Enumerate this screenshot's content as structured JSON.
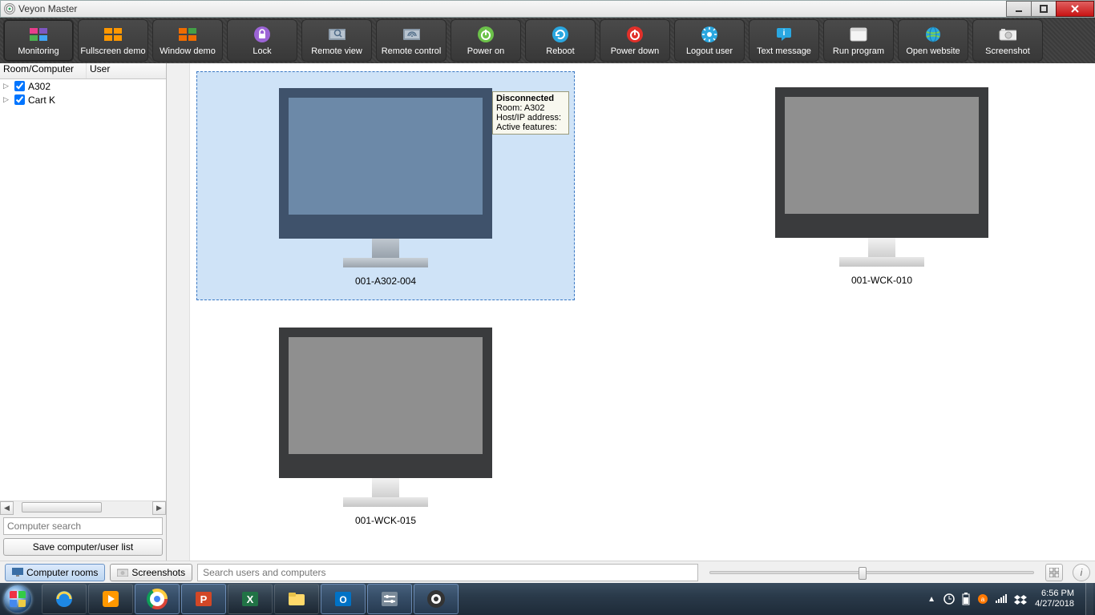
{
  "window": {
    "title": "Veyon Master"
  },
  "toolbar": [
    {
      "label": "Monitoring",
      "icon": "tiles-multi",
      "active": true
    },
    {
      "label": "Fullscreen demo",
      "icon": "tiles-orange"
    },
    {
      "label": "Window demo",
      "icon": "tiles-orange2"
    },
    {
      "label": "Lock",
      "icon": "lock"
    },
    {
      "label": "Remote view",
      "icon": "magnify-screen"
    },
    {
      "label": "Remote control",
      "icon": "wifi-screen"
    },
    {
      "label": "Power on",
      "icon": "power-green"
    },
    {
      "label": "Reboot",
      "icon": "reload-blue"
    },
    {
      "label": "Power down",
      "icon": "power-red"
    },
    {
      "label": "Logout user",
      "icon": "sun-blue"
    },
    {
      "label": "Text message",
      "icon": "chat-blue"
    },
    {
      "label": "Run program",
      "icon": "window-white"
    },
    {
      "label": "Open website",
      "icon": "globe"
    },
    {
      "label": "Screenshot",
      "icon": "camera"
    }
  ],
  "tree": {
    "headers": {
      "col1": "Room/Computer",
      "col2": "User"
    },
    "rows": [
      {
        "label": "A302",
        "checked": true
      },
      {
        "label": "Cart K",
        "checked": true
      }
    ]
  },
  "sidebar": {
    "search_placeholder": "Computer search",
    "save_label": "Save computer/user list"
  },
  "computers": [
    {
      "name": "001-A302-004",
      "selected": true,
      "state": "selected"
    },
    {
      "name": "001-WCK-010",
      "selected": false,
      "state": "off"
    },
    {
      "name": "001-WCK-015",
      "selected": false,
      "state": "off"
    }
  ],
  "tooltip": {
    "title": "Disconnected",
    "room": "Room: A302",
    "host": "Host/IP address:",
    "features": "Active features:"
  },
  "bottom": {
    "tab_rooms": "Computer rooms",
    "tab_screenshots": "Screenshots",
    "search_placeholder": "Search users and computers"
  },
  "clock": {
    "time": "6:56 PM",
    "date": "4/27/2018"
  }
}
